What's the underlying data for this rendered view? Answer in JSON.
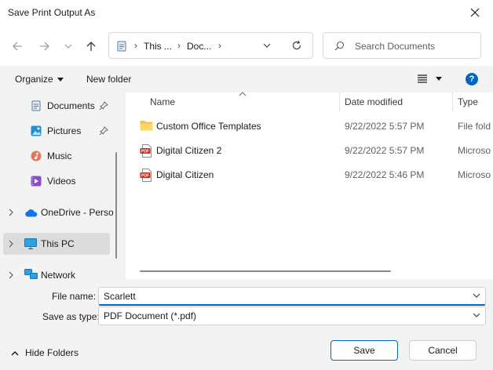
{
  "window": {
    "title": "Save Print Output As"
  },
  "address": {
    "crumbs": [
      "This ...",
      "Doc..."
    ],
    "search_placeholder": "Search Documents"
  },
  "commandbar": {
    "organize": "Organize",
    "new_folder": "New folder",
    "help": "?"
  },
  "navpane": {
    "items": [
      {
        "label": "Documents",
        "icon": "documents-icon",
        "pinned": true
      },
      {
        "label": "Pictures",
        "icon": "pictures-icon",
        "pinned": true
      },
      {
        "label": "Music",
        "icon": "music-icon",
        "pinned": false
      },
      {
        "label": "Videos",
        "icon": "videos-icon",
        "pinned": false
      },
      {
        "label": "OneDrive - Perso",
        "icon": "onedrive-icon",
        "expandable": true
      },
      {
        "label": "This PC",
        "icon": "this-pc-icon",
        "expandable": true,
        "selected": true
      },
      {
        "label": "Network",
        "icon": "network-icon",
        "expandable": true
      }
    ]
  },
  "filelist": {
    "columns": [
      "Name",
      "Date modified",
      "Type"
    ],
    "rows": [
      {
        "name": "Custom Office Templates",
        "date": "9/22/2022 5:57 PM",
        "type": "File fold",
        "icon": "folder-icon"
      },
      {
        "name": "Digital Citizen 2",
        "date": "9/22/2022 5:57 PM",
        "type": "Microso",
        "icon": "pdf-icon"
      },
      {
        "name": "Digital Citizen",
        "date": "9/22/2022 5:46 PM",
        "type": "Microso",
        "icon": "pdf-icon"
      }
    ]
  },
  "form": {
    "file_name_label": "File name:",
    "file_name_value": "Scarlett",
    "save_as_type_label": "Save as type:",
    "save_as_type_value": "PDF Document (*.pdf)",
    "hide_folders": "Hide Folders",
    "save": "Save",
    "cancel": "Cancel"
  },
  "colors": {
    "accent": "#0067c0",
    "folder": "#f5c242",
    "pdf": "#c42b1c"
  }
}
